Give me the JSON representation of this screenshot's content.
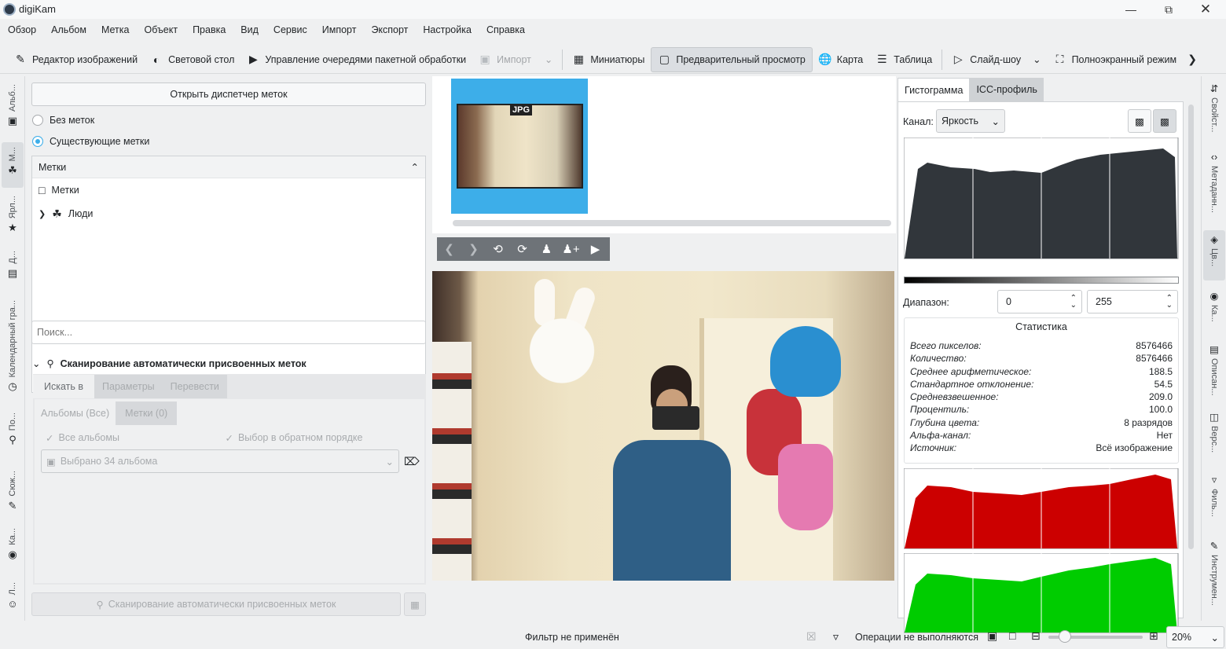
{
  "window": {
    "title": "digiKam"
  },
  "menu": [
    "Обзор",
    "Альбом",
    "Метка",
    "Объект",
    "Правка",
    "Вид",
    "Сервис",
    "Импорт",
    "Экспорт",
    "Настройка",
    "Справка"
  ],
  "toolbar": {
    "image_editor": "Редактор изображений",
    "light_table": "Световой стол",
    "batch_queue": "Управление очередями пакетной обработки",
    "import": "Импорт",
    "thumbnails": "Миниатюры",
    "preview": "Предварительный просмотр",
    "map": "Карта",
    "table": "Таблица",
    "slideshow": "Слайд-шоу",
    "fullscreen": "Полноэкранный режим"
  },
  "left_sidebar": [
    "Альб...",
    "М...",
    "Ярл...",
    "Д...",
    "Календарный гра...",
    "По...",
    "Сюж...",
    "Ка...",
    "Л..."
  ],
  "tags_panel": {
    "open_manager": "Открыть диспетчер меток",
    "no_tags": "Без меток",
    "existing_tags": "Существующие метки",
    "tree_header": "Метки",
    "tree_root": "Метки",
    "tree_child": "Люди",
    "search_placeholder": "Поиск...",
    "scan_section": "Сканирование автоматически присвоенных меток",
    "scan_tabs": [
      "Искать в",
      "Параметры",
      "Перевести"
    ],
    "sub_tabs": [
      "Альбомы (Все)",
      "Метки (0)"
    ],
    "all_albums": "Все альбомы",
    "reverse_order": "Выбор в обратном порядке",
    "albums_selected": "Выбрано 34 альбома",
    "scan_button": "Сканирование автоматически присвоенных меток"
  },
  "thumbnail": {
    "badge": "JPG"
  },
  "right_panel": {
    "tabs": [
      "Гистограмма",
      "ICC-профиль"
    ],
    "channel_label": "Канал:",
    "channel_value": "Яркость",
    "range_label": "Диапазон:",
    "range_min": "0",
    "range_max": "255",
    "stats_title": "Статистика",
    "stats": [
      {
        "k": "Всего пикселов:",
        "v": "8576466"
      },
      {
        "k": "Количество:",
        "v": "8576466"
      },
      {
        "k": "Среднее арифметическое:",
        "v": "188.5"
      },
      {
        "k": "Стандартное отклонение:",
        "v": "54.5"
      },
      {
        "k": "Средневзвешенное:",
        "v": "209.0"
      },
      {
        "k": "Процентиль:",
        "v": "100.0"
      },
      {
        "k": "Глубина цвета:",
        "v": "8 разрядов"
      },
      {
        "k": "Альфа-канал:",
        "v": "Нет"
      },
      {
        "k": "Источник:",
        "v": "Всё изображение"
      }
    ],
    "colors": {
      "luma": "#31363b",
      "red": "#cc0000",
      "green": "#00cc00"
    }
  },
  "right_sidebar": [
    "Свойст...",
    "Метаданн...",
    "Цв...",
    "Ка...",
    "Описан...",
    "Верс...",
    "Филь...",
    "Инструмен..."
  ],
  "status": {
    "filter": "Фильтр не применён",
    "ops": "Операции не выполняются",
    "zoom": "20%"
  }
}
